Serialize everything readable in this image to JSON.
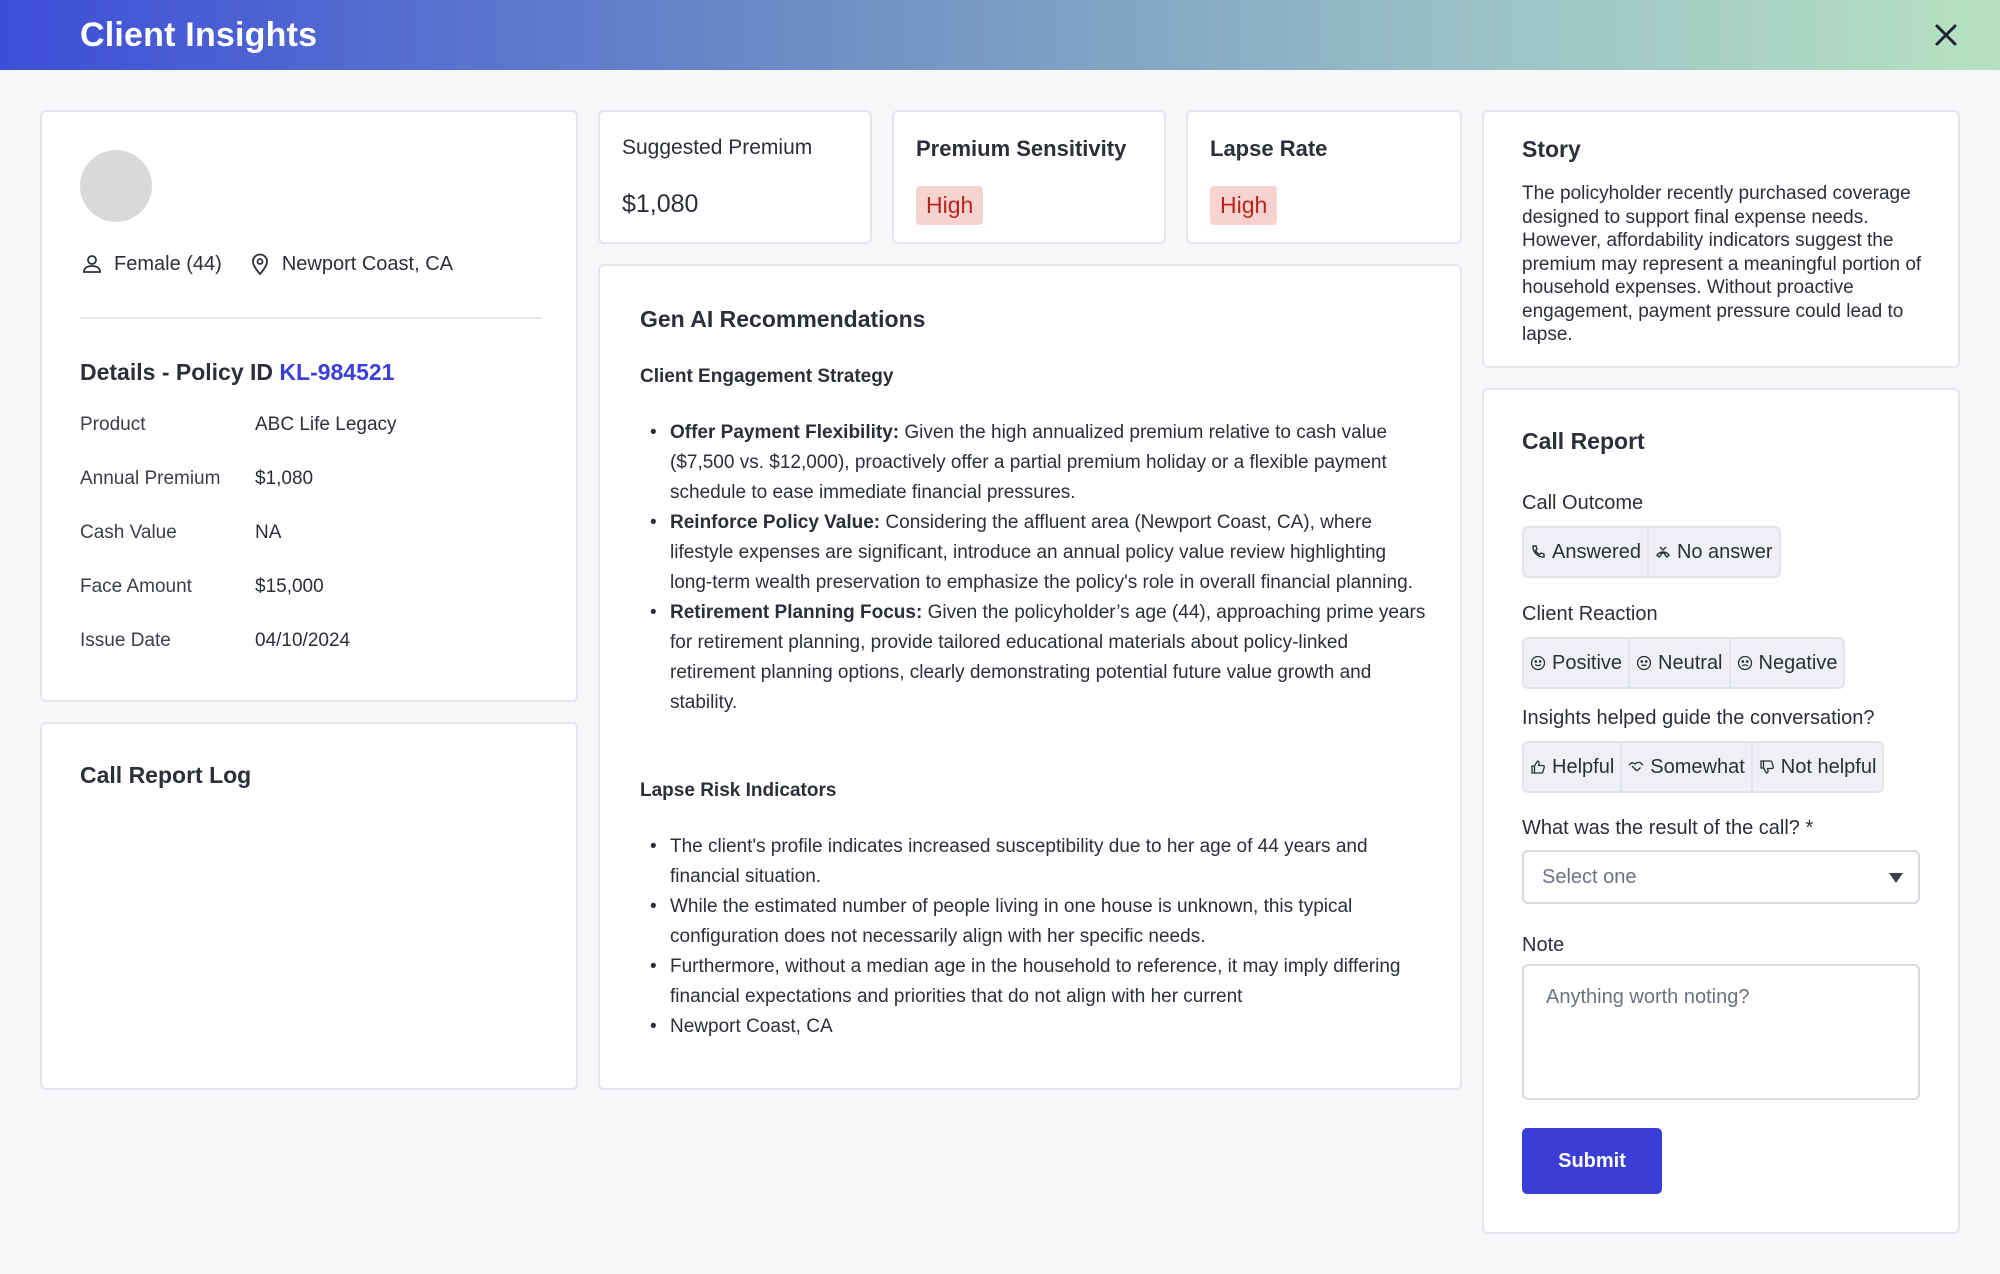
{
  "window": {
    "title": "Client Insights",
    "close_icon": "close-icon"
  },
  "profile": {
    "gender_age": "Female (44)",
    "location": "Newport Coast, CA",
    "details_title": "Details - Policy ID ",
    "policy_id": "KL-984521",
    "details": [
      {
        "label": "Product",
        "value": "ABC Life Legacy"
      },
      {
        "label": "Annual Premium",
        "value": "$1,080"
      },
      {
        "label": "Cash Value",
        "value": "NA"
      },
      {
        "label": "Face Amount",
        "value": "$15,000"
      },
      {
        "label": "Issue Date",
        "value": "04/10/2024"
      }
    ]
  },
  "call_report_log": {
    "title": "Call Report Log"
  },
  "metrics": {
    "suggested_premium": {
      "label": "Suggested Premium",
      "value": "$1,080"
    },
    "premium_sensitivity": {
      "label": "Premium Sensitivity",
      "value": "High"
    },
    "lapse_rate": {
      "label": "Lapse Rate",
      "value": "High"
    },
    "badge_color": "#f7d3d0",
    "badge_text_color": "#b8241c"
  },
  "recommendations": {
    "title": "Gen AI Recommendations",
    "engagement_title": "Client Engagement Strategy",
    "engagement": [
      {
        "bold": "Offer Payment Flexibility:",
        "text": " Given the high annualized premium relative to cash value ($7,500 vs. $12,000), proactively offer a partial premium holiday or a flexible payment schedule to ease immediate financial pressures."
      },
      {
        "bold": "Reinforce Policy Value:",
        "text": " Considering the affluent area (Newport Coast, CA), where lifestyle expenses are significant, introduce an annual policy value review highlighting long-term wealth preservation to emphasize the policy's role in overall financial planning."
      },
      {
        "bold": "Retirement Planning Focus:",
        "text": " Given the policyholder’s age (44), approaching prime years for retirement planning, provide tailored educational materials about policy-linked retirement planning options, clearly demonstrating potential future value growth and stability."
      }
    ],
    "lapse_title": "Lapse Risk Indicators",
    "lapse": [
      "The client's profile indicates increased susceptibility due to her age of 44 years and financial situation.",
      "While the estimated number of people living in one house is unknown, this typical configuration does not necessarily align with her specific needs.",
      "Furthermore, without a median age in the household to reference, it may imply differing financial expectations and priorities that do not align with her current",
      "Newport Coast, CA"
    ]
  },
  "story": {
    "title": "Story",
    "text": "The policyholder recently purchased coverage designed to support final expense needs. However, affordability indicators suggest the premium may represent a meaningful portion of household expenses. Without proactive engagement, payment pressure could lead to lapse."
  },
  "call_report": {
    "title": "Call Report",
    "outcome_label": "Call Outcome",
    "outcome_options": [
      "Answered",
      "No answer"
    ],
    "reaction_label": "Client Reaction",
    "reaction_options": [
      "Positive",
      "Neutral",
      "Negative"
    ],
    "insights_label": "Insights helped guide the conversation?",
    "insights_options": [
      "Helpful",
      "Somewhat",
      "Not helpful"
    ],
    "result_label": "What was the result of the call? *",
    "result_placeholder": "Select one",
    "note_label": "Note",
    "note_placeholder": "Anything worth noting?",
    "submit_label": "Submit",
    "accent_color": "#3a3dd6"
  }
}
